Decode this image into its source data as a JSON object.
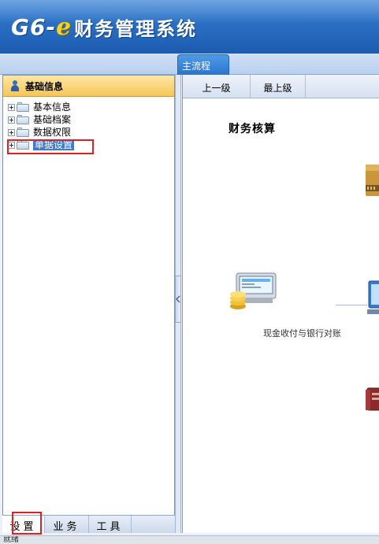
{
  "app": {
    "logo_g6": "G6-",
    "logo_e": "e",
    "title": "财务管理系统"
  },
  "main_tab": {
    "label": "主流程"
  },
  "left_panel": {
    "header": "基础信息",
    "tree": [
      {
        "label": "基本信息"
      },
      {
        "label": "基础档案"
      },
      {
        "label": "数据权限"
      },
      {
        "label": "单据设置",
        "selected": true
      }
    ],
    "bottom_tabs": [
      {
        "label": "设置",
        "active": true
      },
      {
        "label": "业务"
      },
      {
        "label": "工具"
      }
    ]
  },
  "toolbar": {
    "up_one_level": "上一级",
    "top_level": "最上级"
  },
  "workflow": {
    "section_title": "财务核算",
    "nodes": [
      {
        "caption": "现金收付与银行对账",
        "icon": "cash-register-icon"
      },
      {
        "icon": "archive-box-icon"
      },
      {
        "icon": "computer-screen-icon"
      },
      {
        "icon": "ledger-book-icon"
      }
    ]
  },
  "status": {
    "text": "就绪"
  },
  "colors": {
    "header_blue": "#2a6fc4",
    "panel_header_gold": "#f6c65a",
    "selection_blue": "#3a7bd5",
    "highlight_red": "#e02020"
  }
}
